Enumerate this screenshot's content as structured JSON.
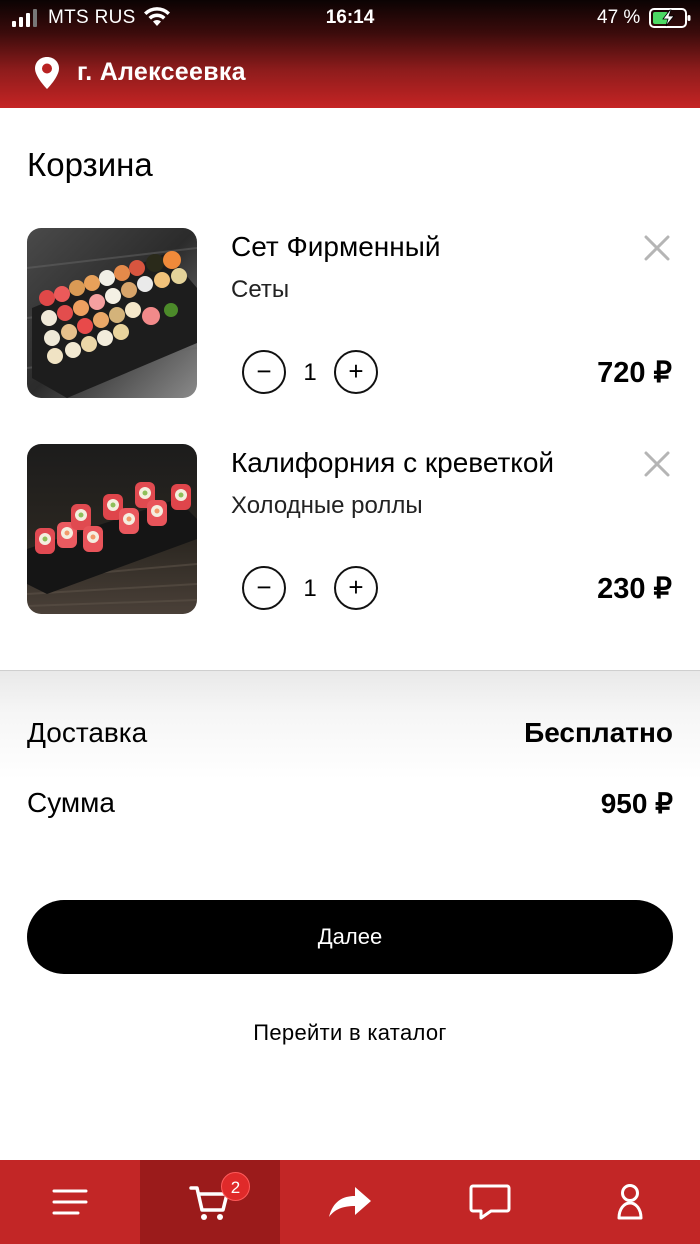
{
  "status_bar": {
    "carrier": "MTS RUS",
    "time": "16:14",
    "battery": "47 %"
  },
  "header": {
    "location": "г. Алексеевка"
  },
  "cart": {
    "title": "Корзина",
    "items": [
      {
        "name": "Сет Фирменный",
        "category": "Сеты",
        "quantity": "1",
        "price": "720 ₽",
        "icon": "sushi-set-image"
      },
      {
        "name": "Калифорния с креветкой",
        "category": "Холодные роллы",
        "quantity": "1",
        "price": "230 ₽",
        "icon": "california-roll-image"
      }
    ]
  },
  "summary": {
    "delivery_label": "Доставка",
    "delivery_value": "Бесплатно",
    "total_label": "Сумма",
    "total_value": "950 ₽"
  },
  "actions": {
    "next_label": "Далее",
    "catalog_label": "Перейти в каталог"
  },
  "tabbar": {
    "cart_badge": "2",
    "tabs": [
      "menu-icon",
      "cart-icon",
      "share-icon",
      "chat-icon",
      "profile-icon"
    ],
    "active_tab": "cart-icon"
  },
  "colors": {
    "brand_red": "#c22626",
    "active_tab": "#9b1b1b",
    "button": "#000000"
  }
}
